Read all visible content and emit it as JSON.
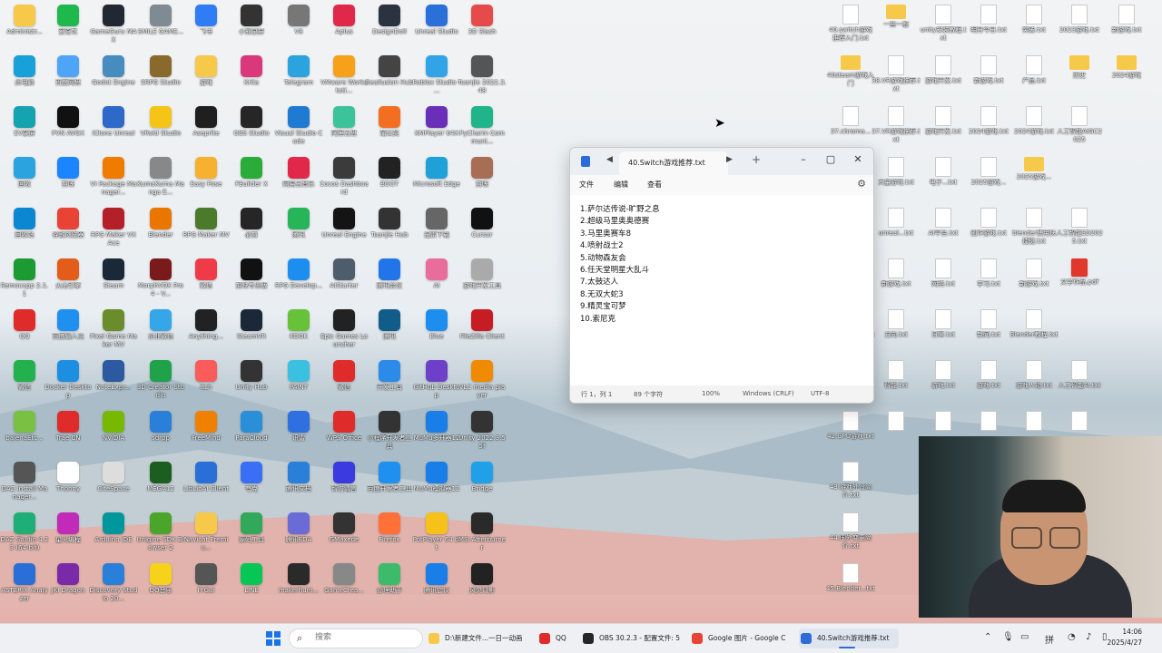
{
  "desktop_left_icons": [
    {
      "label": "Administr...",
      "color": "#f6c94b"
    },
    {
      "label": "爱奇艺",
      "color": "#1fb84d"
    },
    {
      "label": "GameGuru MAX",
      "color": "#222831"
    },
    {
      "label": "SMILE GAME...",
      "color": "#808a93"
    },
    {
      "label": "飞书",
      "color": "#2f7cf6"
    },
    {
      "label": "小熊录屏",
      "color": "#333333"
    },
    {
      "label": "V8",
      "color": "#777777"
    },
    {
      "label": "Aplus",
      "color": "#e0294a"
    },
    {
      "label": "DesignDoll",
      "color": "#2b3340"
    },
    {
      "label": "Unreal Studio",
      "color": "#2b6fd9"
    },
    {
      "label": "3D Slash",
      "color": "#e54b4b"
    },
    {
      "label": "此电脑",
      "color": "#18a0d8"
    },
    {
      "label": "百度网盘",
      "color": "#4ea5f7"
    },
    {
      "label": "Godot Engine",
      "color": "#478cbf"
    },
    {
      "label": "SRPG Studio",
      "color": "#8a6a2c"
    },
    {
      "label": "游戏",
      "color": "#f6c94b"
    },
    {
      "label": "Krita",
      "color": "#d9397a"
    },
    {
      "label": "Telegram",
      "color": "#2aa3df"
    },
    {
      "label": "VMware Workstati...",
      "color": "#f7a11a"
    },
    {
      "label": "Reallusion Hub",
      "color": "#444444"
    },
    {
      "label": "Roblox Studio - ...",
      "color": "#31a4e8"
    },
    {
      "label": "Tuanjie 2022.3.48",
      "color": "#555555"
    },
    {
      "label": "EV录屏",
      "color": "#15a3b0"
    },
    {
      "label": "PVN AVGX",
      "color": "#111111"
    },
    {
      "label": "iClone Unreal",
      "color": "#2e68c9"
    },
    {
      "label": "VRoid Studio",
      "color": "#f4c516"
    },
    {
      "label": "Aseprite",
      "color": "#1f1f1f"
    },
    {
      "label": "OBS Studio",
      "color": "#262626"
    },
    {
      "label": "Visual Studio Code",
      "color": "#1e7bd1"
    },
    {
      "label": "阿里云盘",
      "color": "#3cc39a"
    },
    {
      "label": "蒲公英",
      "color": "#f26f21"
    },
    {
      "label": "KMPlayer 64X",
      "color": "#6a2fb8"
    },
    {
      "label": "PyCharm Communi...",
      "color": "#1fb48a"
    },
    {
      "label": "回收",
      "color": "#2aa3df"
    },
    {
      "label": "剪映",
      "color": "#1b84ff"
    },
    {
      "label": "VI Package Manager...",
      "color": "#ef7b00"
    },
    {
      "label": "KumaKuma Manga E...",
      "color": "#888888"
    },
    {
      "label": "Easy Pose",
      "color": "#f7b030"
    },
    {
      "label": "FBuilder X",
      "color": "#2bac3a"
    },
    {
      "label": "网易云音乐",
      "color": "#e1284a"
    },
    {
      "label": "Cocos Dashboard",
      "color": "#3b3b3b"
    },
    {
      "label": "BOOT",
      "color": "#222222"
    },
    {
      "label": "Microsoft Edge",
      "color": "#1fa0d8"
    },
    {
      "label": "剪映",
      "color": "#a86e55"
    },
    {
      "label": "回收站",
      "color": "#0b86d0"
    },
    {
      "label": "谷歌浏览器",
      "color": "#e84335"
    },
    {
      "label": "RPG Maker VX Ace",
      "color": "#b3202a"
    },
    {
      "label": "Blender",
      "color": "#ea7600"
    },
    {
      "label": "RPG Maker MV",
      "color": "#4b7a2a"
    },
    {
      "label": "必剪",
      "color": "#262626"
    },
    {
      "label": "腾讯",
      "color": "#27b55a"
    },
    {
      "label": "Unreal Engine",
      "color": "#141414"
    },
    {
      "label": "Tuanjie Hub",
      "color": "#333333"
    },
    {
      "label": "迅雷下载",
      "color": "#666666"
    },
    {
      "label": "Cursor",
      "color": "#111111"
    },
    {
      "label": "Remocapp 2.1.1",
      "color": "#1c9b33"
    },
    {
      "label": "火山引擎",
      "color": "#e35c1a"
    },
    {
      "label": "Steam",
      "color": "#1b2838"
    },
    {
      "label": "MorphVOX Pro 4 - V...",
      "color": "#7a1a1a"
    },
    {
      "label": "微信",
      "color": "#ef3a48"
    },
    {
      "label": "剪映专业版",
      "color": "#111111"
    },
    {
      "label": "RPG Develop...",
      "color": "#1c8ef0"
    },
    {
      "label": "AIStarter",
      "color": "#4d5d6b"
    },
    {
      "label": "腾讯会议",
      "color": "#2175e8"
    },
    {
      "label": "AI",
      "color": "#e86d9a"
    },
    {
      "label": "游戏开发工具",
      "color": "#aaaaaa"
    },
    {
      "label": "QQ",
      "color": "#e02b2b"
    },
    {
      "label": "百度输入法",
      "color": "#1f8ff0"
    },
    {
      "label": "Pixel Game Maker MV",
      "color": "#6b8c2a"
    },
    {
      "label": "企业微信",
      "color": "#35a6e8"
    },
    {
      "label": "Anything...",
      "color": "#222222"
    },
    {
      "label": "SteamVR",
      "color": "#1b2838"
    },
    {
      "label": "KOOK",
      "color": "#67c23a"
    },
    {
      "label": "Epic Games Launcher",
      "color": "#222222"
    },
    {
      "label": "腾讯",
      "color": "#125c8a"
    },
    {
      "label": "Blue",
      "color": "#1c8ef0"
    },
    {
      "label": "FileZilla Client",
      "color": "#c51d23"
    },
    {
      "label": "微信",
      "color": "#22b14c"
    },
    {
      "label": "Docker Desktop",
      "color": "#1d8fe3"
    },
    {
      "label": "NoteExpr...",
      "color": "#2c5aa0"
    },
    {
      "label": "3D Creator Studio",
      "color": "#1fa24a"
    },
    {
      "label": "itch",
      "color": "#fa5c5c"
    },
    {
      "label": "Unity Hub",
      "color": "#333333"
    },
    {
      "label": "PAINT",
      "color": "#3cc0e0"
    },
    {
      "label": "微信",
      "color": "#e02b2b"
    },
    {
      "label": "开发工具",
      "color": "#2c8be8"
    },
    {
      "label": "GitHub Desktop",
      "color": "#6e40c9"
    },
    {
      "label": "VLC media player",
      "color": "#f08a00"
    },
    {
      "label": "balenaEtc...",
      "color": "#7ac143"
    },
    {
      "label": "Trae CN",
      "color": "#e02b2b"
    },
    {
      "label": "NVIDIA",
      "color": "#76b900"
    },
    {
      "label": "sdrpp",
      "color": "#2a7fd8"
    },
    {
      "label": "FreeMind",
      "color": "#f08000"
    },
    {
      "label": "ParaCloud",
      "color": "#2a8fd8"
    },
    {
      "label": "讯雷",
      "color": "#2f6fe0"
    },
    {
      "label": "WPS Office",
      "color": "#e02b2b"
    },
    {
      "label": "小程序开发者工具",
      "color": "#333333"
    },
    {
      "label": "MuMu多开器12",
      "color": "#1a7ee8"
    },
    {
      "label": "Unity 2022.3.55f",
      "color": "#333333"
    },
    {
      "label": "DAZ Install Manager...",
      "color": "#555555"
    },
    {
      "label": "Thonny",
      "color": "#ffffff"
    },
    {
      "label": "CiteSpace",
      "color": "#dddddd"
    },
    {
      "label": "MEGA12",
      "color": "#1b5e20"
    },
    {
      "label": "LibLibAI Client",
      "color": "#2a6fd8"
    },
    {
      "label": "夸克",
      "color": "#3a6ef5"
    },
    {
      "label": "腾讯文档",
      "color": "#2a7fd8"
    },
    {
      "label": "智谱清言",
      "color": "#3a3ae0"
    },
    {
      "label": "百度开发者工具",
      "color": "#1f8ff0"
    },
    {
      "label": "MuMu模拟器12",
      "color": "#1a7ee8"
    },
    {
      "label": "Bridge",
      "color": "#1fa0e8"
    },
    {
      "label": "DAZ Studio 4.23 (64-bit)",
      "color": "#1fae76"
    },
    {
      "label": "星火编程",
      "color": "#c02bb8"
    },
    {
      "label": "Arduino IDE",
      "color": "#00979c"
    },
    {
      "label": "Unigine SDK Browser 2",
      "color": "#4aa52a"
    },
    {
      "label": "Navicat Premiu...",
      "color": "#f6c94b"
    },
    {
      "label": "源码工具",
      "color": "#32a85a"
    },
    {
      "label": "腾讯EDA",
      "color": "#6b6bd8"
    },
    {
      "label": "GMaxede",
      "color": "#333333"
    },
    {
      "label": "Firefox",
      "color": "#ff7139"
    },
    {
      "label": "PotPlayer 64 bit",
      "color": "#f6c21a"
    },
    {
      "label": "MSI Afterburner",
      "color": "#2a2a2a"
    },
    {
      "label": "ASTERIX Analyzer",
      "color": "#2a6fd8"
    },
    {
      "label": "JKI Dragon",
      "color": "#7a2aa8"
    },
    {
      "label": "Discovery Studio 20...",
      "color": "#2a7fd8"
    },
    {
      "label": "QQ音乐",
      "color": "#f6d21a"
    },
    {
      "label": "PrGui",
      "color": "#555555"
    },
    {
      "label": "LINE",
      "color": "#06c755"
    },
    {
      "label": "makerhum...",
      "color": "#2a2a2a"
    },
    {
      "label": "GameCrea...",
      "color": "#888888"
    },
    {
      "label": "办理助手",
      "color": "#3cbc6a"
    },
    {
      "label": "腾讯会议",
      "color": "#1a7ee8"
    },
    {
      "label": "风灵月影",
      "color": "#222222"
    }
  ],
  "desktop_right_icons": [
    {
      "label": "40.switch游戏推荐入门.txt",
      "type": "file"
    },
    {
      "label": "一些一般",
      "type": "folder"
    },
    {
      "label": "unity安装教程.txt",
      "type": "file"
    },
    {
      "label": "明日今日.txt",
      "type": "file"
    },
    {
      "label": "突破.txt",
      "type": "file"
    },
    {
      "label": "2023游戏.txt",
      "type": "file"
    },
    {
      "label": "新游戏.txt",
      "type": "file"
    },
    {
      "label": "40steam游戏入门",
      "type": "folder"
    },
    {
      "label": "38.VR游戏推荐.txt",
      "type": "file"
    },
    {
      "label": "游戏开发.txt",
      "type": "file"
    },
    {
      "label": "新游戏.txt",
      "type": "file"
    },
    {
      "label": "产品.txt",
      "type": "file"
    },
    {
      "label": "历史",
      "type": "folder"
    },
    {
      "label": "2024游戏",
      "type": "folder"
    },
    {
      "label": "37.chrome...",
      "type": "file"
    },
    {
      "label": "37.VR游戏推荐.txt",
      "type": "file"
    },
    {
      "label": "游戏开发.txt",
      "type": "file"
    },
    {
      "label": "2024游戏.txt",
      "type": "file"
    },
    {
      "label": "2024游戏.txt",
      "type": "file"
    },
    {
      "label": "人工智能AIGC2025",
      "type": "file"
    },
    {
      "label": "36.roblox...",
      "type": "file"
    },
    {
      "label": "大量游戏.txt",
      "type": "file"
    },
    {
      "label": "电子...txt",
      "type": "file"
    },
    {
      "label": "2025游戏...",
      "type": "file"
    },
    {
      "label": "2025游戏...",
      "type": "folder"
    },
    {
      "label": "35.PS5游戏...",
      "type": "file"
    },
    {
      "label": "unreal...txt",
      "type": "file"
    },
    {
      "label": "AI平台.txt",
      "type": "file"
    },
    {
      "label": "创作游戏.txt",
      "type": "file"
    },
    {
      "label": "blender使用快捷键.txt",
      "type": "file"
    },
    {
      "label": "人工智能SD2025.txt",
      "type": "file"
    },
    {
      "label": "34.switch...txt",
      "type": "file"
    },
    {
      "label": "新游戏.txt",
      "type": "file"
    },
    {
      "label": "网络.txt",
      "type": "file"
    },
    {
      "label": "学习.txt",
      "type": "file"
    },
    {
      "label": "新游戏.txt",
      "type": "file"
    },
    {
      "label": "文学作品.pdf",
      "type": "pdf"
    },
    {
      "label": "41.PCVR游戏.txt",
      "type": "file"
    },
    {
      "label": "方向.txt",
      "type": "file"
    },
    {
      "label": "日常.txt",
      "type": "file"
    },
    {
      "label": "新闻.txt",
      "type": "file"
    },
    {
      "label": "Blender教程.txt",
      "type": "file"
    },
    {
      "label": "42.XR游戏.txt",
      "type": "folder"
    },
    {
      "label": "智能.txt",
      "type": "file"
    },
    {
      "label": "游戏.txt",
      "type": "file"
    },
    {
      "label": "游戏.txt",
      "type": "file"
    },
    {
      "label": "游戏人物.txt",
      "type": "file"
    },
    {
      "label": "人工智能AI.txt",
      "type": "file"
    },
    {
      "label": "42.GPU游戏.txt",
      "type": "file"
    },
    {
      "label": "",
      "type": "file"
    },
    {
      "label": "",
      "type": "file"
    },
    {
      "label": "",
      "type": "file"
    },
    {
      "label": "",
      "type": "file"
    },
    {
      "label": "",
      "type": "file"
    },
    {
      "label": "43.游戏外设简介.txt",
      "type": "file"
    },
    {
      "label": "44.国外变更简介.txt",
      "type": "file"
    },
    {
      "label": "45.Blender...txt",
      "type": "file"
    }
  ],
  "notepad": {
    "tab_title": "40.Switch游戏推荐.txt",
    "menus": [
      "文件",
      "编辑",
      "查看"
    ],
    "lines": [
      "1.萨尔达传说-旷野之息",
      "2.超级马里奥奥德赛",
      "3.马里奥赛车8",
      "4.喷射战士2",
      "5.动物森友会",
      "6.任天堂明星大乱斗",
      "7.太鼓达人",
      "8.无双大蛇3",
      "9.精灵宝可梦",
      "10.索尼克"
    ],
    "status": {
      "position": "行 1，列 1",
      "chars": "89 个字符",
      "zoom": "100%",
      "line_ending": "Windows (CRLF)",
      "encoding": "UTF-8"
    }
  },
  "taskbar": {
    "search_placeholder": "搜索",
    "tasks": [
      {
        "label": "D:\\新建文件...一日一动画",
        "color": "#f6c94b"
      },
      {
        "label": "QQ",
        "color": "#e02b2b"
      },
      {
        "label": "OBS 30.2.3 - 配置文件: 5",
        "color": "#262626"
      },
      {
        "label": "Google 图片 - Google C",
        "color": "#e84335"
      },
      {
        "label": "40.Switch游戏推荐.txt",
        "color": "#2d6bd8"
      }
    ],
    "tray_ime": "拼",
    "time": "14:06",
    "date": "2025/4/27"
  }
}
